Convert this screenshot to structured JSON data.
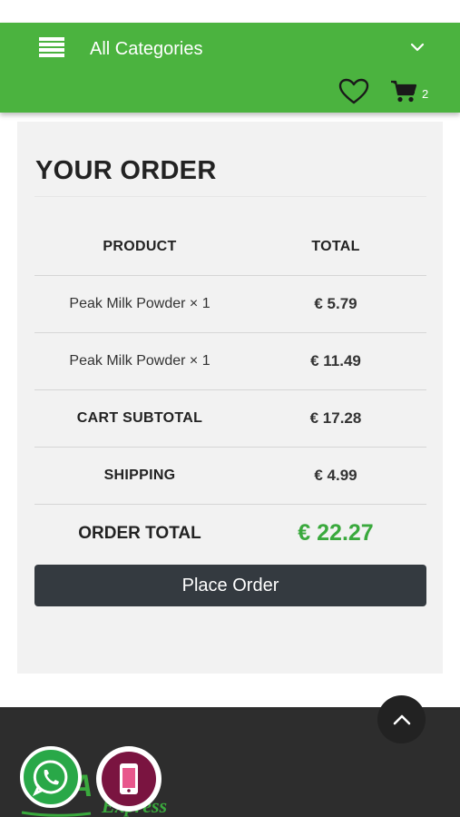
{
  "header": {
    "category_label": "All Categories",
    "cart_count": "2"
  },
  "order": {
    "title": "YOUR ORDER",
    "columns": {
      "product": "PRODUCT",
      "total": "TOTAL"
    },
    "items": [
      {
        "name": "Peak Milk Powder × 1",
        "price": "€ 5.79"
      },
      {
        "name": "Peak Milk Powder × 1",
        "price": "€ 11.49"
      }
    ],
    "subtotal_label": "CART SUBTOTAL",
    "subtotal_value": "€ 17.28",
    "shipping_label": "SHIPPING",
    "shipping_value": "€ 4.99",
    "order_total_label": "ORDER TOTAL",
    "order_total_value": "€ 22.27",
    "place_order_label": "Place Order"
  },
  "footer": {
    "logo_text": "Food Express"
  },
  "colors": {
    "header_green": "#4bb33f",
    "total_green": "#3aa93d",
    "button_dark": "#343a40",
    "footer_dark": "#2d2d2d",
    "whatsapp_green": "#29a848",
    "phone_maroon": "#7a1440"
  },
  "icons": [
    "menu-icon",
    "chevron-down-icon",
    "heart-icon",
    "cart-icon",
    "arrow-up-icon",
    "whatsapp-icon",
    "phone-icon"
  ]
}
